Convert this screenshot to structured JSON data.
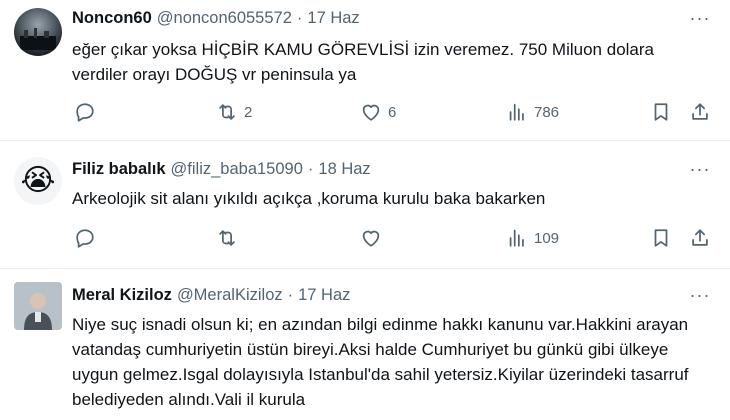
{
  "tweets": [
    {
      "name": "Noncon60",
      "handle": "@noncon6055572",
      "sep": "·",
      "date": "17 Haz",
      "text": "eğer çıkar yoksa HİÇBİR KAMU GÖREVLİSİ izin veremez. 750 Miluon dolara verdiler orayı DOĞUŞ  vr peninsula ya",
      "replies": "",
      "retweets": "2",
      "likes": "6",
      "views": "786"
    },
    {
      "name": "Filiz babalık",
      "handle": "@filiz_baba15090",
      "sep": "·",
      "date": "18 Haz",
      "avatar_emoji": "😭",
      "text": "Arkeolojik sit alanı yıkıldı açıkça ,koruma kurulu baka bakarken",
      "replies": "",
      "retweets": "",
      "likes": "",
      "views": "109"
    },
    {
      "name": "Meral Kiziloz",
      "handle": "@MeralKiziloz",
      "sep": "·",
      "date": "17 Haz",
      "text": "Niye suç isnadi olsun ki; en azından bilgi edinme hakkı kanunu var.Hakkini arayan vatandaş cumhuriyetin üstün bireyi.Aksi halde Cumhuriyet bu günkü gibi ülkeye uygun gelmez.Isgal dolayısıyla Istanbul'da sahil yetersiz.Kiyilar üzerindeki tasarruf belediyeden alındı.Vali il kurula"
    }
  ],
  "more_glyph": "···",
  "icons": [
    "reply-icon",
    "retweet-icon",
    "like-icon",
    "views-icon",
    "bookmark-icon",
    "share-icon"
  ],
  "colors": {
    "text": "#0f1419",
    "secondary": "#536471",
    "divider": "#e6ecf0"
  }
}
